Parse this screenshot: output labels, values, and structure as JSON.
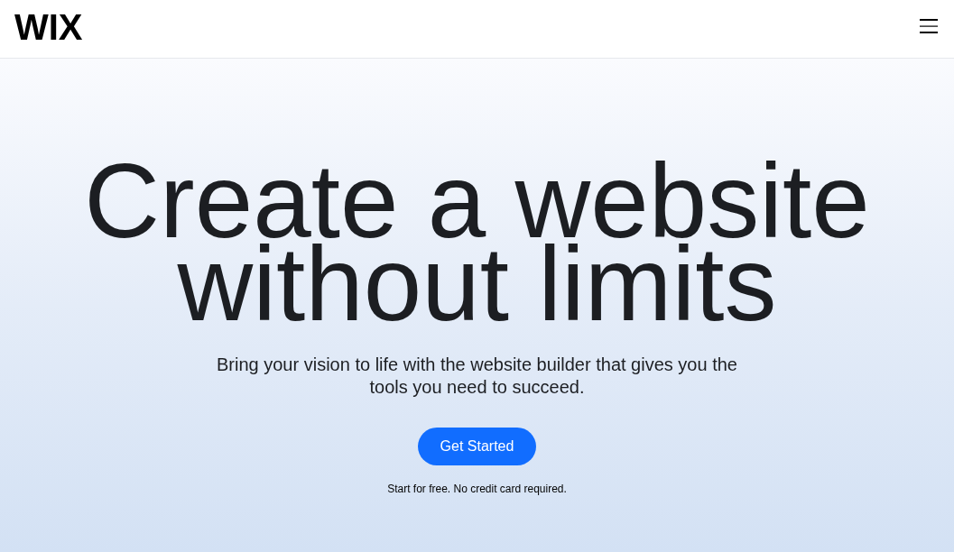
{
  "header": {
    "logo": "WIX"
  },
  "hero": {
    "headline": "Create a website without limits",
    "subtitle": "Bring your vision to life with the website builder that gives you the tools you need to succeed.",
    "cta_button": "Get Started",
    "note": "Start for free. No credit card required."
  }
}
